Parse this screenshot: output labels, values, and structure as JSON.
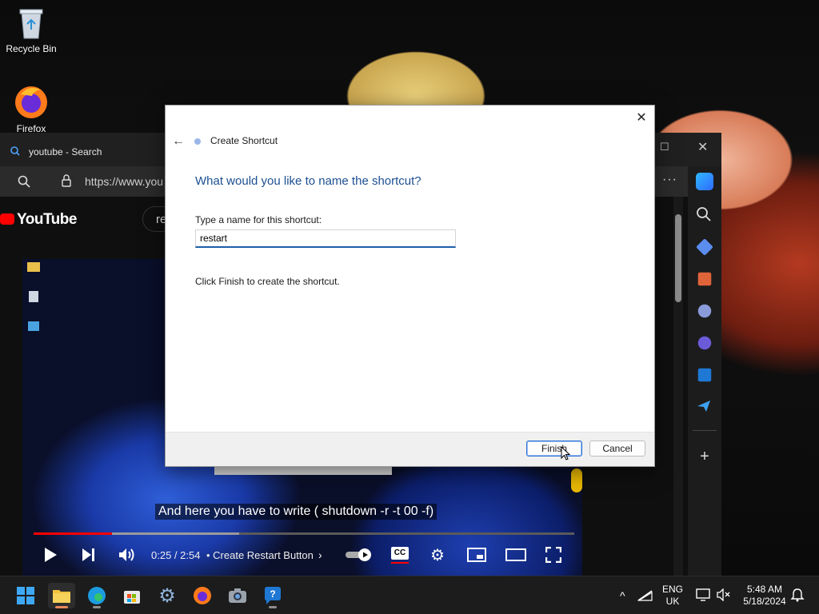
{
  "desktop": {
    "icons": [
      {
        "label": "Recycle Bin",
        "icon": "recycle-bin-icon"
      },
      {
        "label": "Firefox",
        "icon": "firefox-icon"
      }
    ]
  },
  "browser": {
    "tab_title": "youtube - Search",
    "url": "https://www.you",
    "site_logo": "YouTube",
    "search_fragment": "re",
    "video": {
      "caption": "And here you have to write ( shutdown -r -t 00 -f)",
      "time": "0:25 / 2:54",
      "chapter": "• Create Restart Button",
      "progress_played": 0.145,
      "progress_buffered": 0.38,
      "cc_on": true
    }
  },
  "dialog": {
    "title": "Create Shortcut",
    "heading": "What would you like to name the shortcut?",
    "field_label": "Type a name for this shortcut:",
    "field_value": "restart",
    "note": "Click Finish to create the shortcut.",
    "finish_label": "Finish",
    "cancel_label": "Cancel",
    "close_glyph": "✕",
    "back_glyph": "←"
  },
  "taskbar": {
    "apps": [
      "start",
      "file-explorer",
      "edge",
      "microsoft-store",
      "settings",
      "firefox",
      "camera",
      "get-help"
    ],
    "active_app": "file-explorer",
    "language_line1": "ENG",
    "language_line2": "UK",
    "time": "5:48 AM",
    "date": "5/18/2024"
  },
  "colors": {
    "dialog_heading": "#1d4f91",
    "accent": "#2a6fd6",
    "youtube_red": "#ff0000",
    "taskbar_bg": "#1c1c1c"
  }
}
